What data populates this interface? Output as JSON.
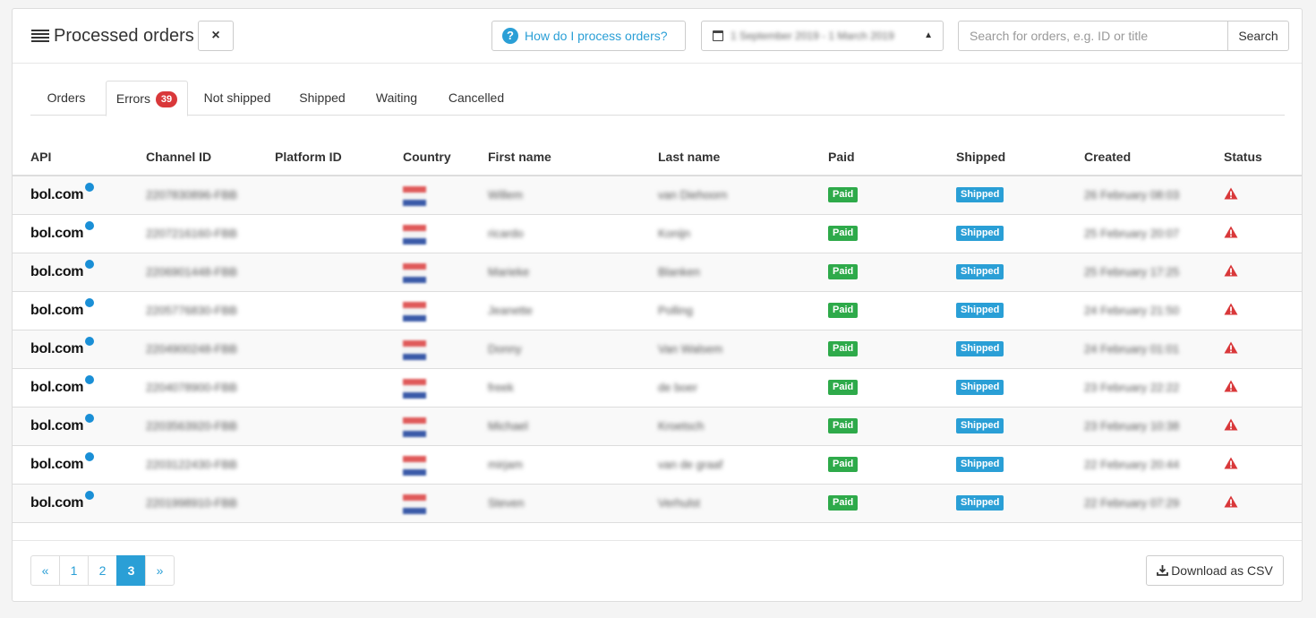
{
  "header": {
    "title": "Processed orders",
    "close_label": "×",
    "help_label": "How do I process orders?",
    "help_icon": "?",
    "date_range": "1 September 2019 - 1 March 2019",
    "search_placeholder": "Search for orders, e.g. ID or title",
    "search_label": "Search"
  },
  "tabs": [
    {
      "label": "Orders"
    },
    {
      "label": "Errors",
      "badge": "39"
    },
    {
      "label": "Not shipped"
    },
    {
      "label": "Shipped"
    },
    {
      "label": "Waiting"
    },
    {
      "label": "Cancelled"
    }
  ],
  "columns": [
    "API",
    "Channel ID",
    "Platform ID",
    "Country",
    "First name",
    "Last name",
    "Paid",
    "Shipped",
    "Created",
    "Status"
  ],
  "rows": [
    {
      "api": "bol.com",
      "channel_id": "2207830896-FBB",
      "first": "Willem",
      "last": "van Diehoorn",
      "paid": "Paid",
      "shipped": "Shipped",
      "created": "26 February 08:03"
    },
    {
      "api": "bol.com",
      "channel_id": "2207216160-FBB",
      "first": "ricardo",
      "last": "Konijn",
      "paid": "Paid",
      "shipped": "Shipped",
      "created": "25 February 20:07"
    },
    {
      "api": "bol.com",
      "channel_id": "2206901448-FBB",
      "first": "Marieke",
      "last": "Blanken",
      "paid": "Paid",
      "shipped": "Shipped",
      "created": "25 February 17:25"
    },
    {
      "api": "bol.com",
      "channel_id": "2205776830-FBB",
      "first": "Jeanette",
      "last": "Polling",
      "paid": "Paid",
      "shipped": "Shipped",
      "created": "24 February 21:50"
    },
    {
      "api": "bol.com",
      "channel_id": "2204900248-FBB",
      "first": "Donny",
      "last": "Van Walsem",
      "paid": "Paid",
      "shipped": "Shipped",
      "created": "24 February 01:01"
    },
    {
      "api": "bol.com",
      "channel_id": "2204078900-FBB",
      "first": "freek",
      "last": "de boer",
      "paid": "Paid",
      "shipped": "Shipped",
      "created": "23 February 22:22"
    },
    {
      "api": "bol.com",
      "channel_id": "2203563920-FBB",
      "first": "Michael",
      "last": "Kroetsch",
      "paid": "Paid",
      "shipped": "Shipped",
      "created": "23 February 10:38"
    },
    {
      "api": "bol.com",
      "channel_id": "2203122430-FBB",
      "first": "mirjam",
      "last": "van de graaf",
      "paid": "Paid",
      "shipped": "Shipped",
      "created": "22 February 20:44"
    },
    {
      "api": "bol.com",
      "channel_id": "2201998910-FBB",
      "first": "Steven",
      "last": "Verhulst",
      "paid": "Paid",
      "shipped": "Shipped",
      "created": "22 February 07:29"
    }
  ],
  "pagination": {
    "prev": "«",
    "pages": [
      "1",
      "2",
      "3"
    ],
    "active": "3",
    "next": "»"
  },
  "footer": {
    "download_label": "Download as CSV"
  },
  "colors": {
    "accent": "#2a9fd6",
    "paid": "#2eaa4a",
    "error": "#d9383a"
  },
  "icons": {
    "menu": "menu-icon",
    "calendar": "calendar-icon",
    "warning": "warning-icon",
    "download": "download-icon"
  }
}
